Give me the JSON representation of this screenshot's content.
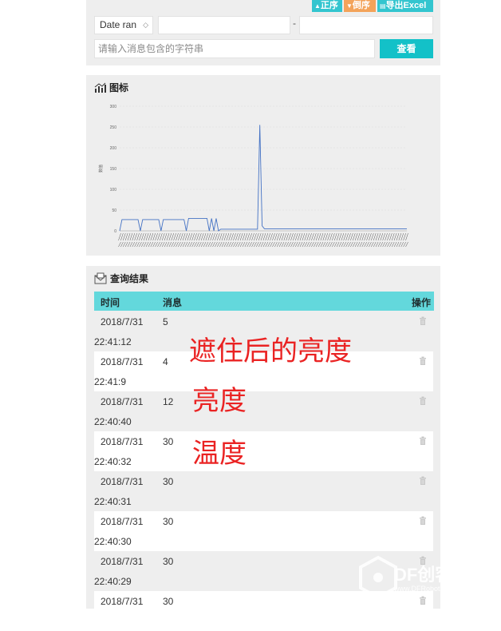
{
  "toolbar": {
    "asc_label": "正序",
    "desc_label": "倒序",
    "export_label": "导出Excel"
  },
  "filter": {
    "range_select": "Date ran",
    "search_placeholder": "请输入消息包含的字符串",
    "query_label": "查看",
    "separator": "-"
  },
  "chart_panel": {
    "title": "图标"
  },
  "result_panel": {
    "title": "查询结果",
    "columns": [
      "时间",
      "消息",
      "操作"
    ]
  },
  "rows": [
    {
      "date": "2018/7/31",
      "time": "22:41:12",
      "msg": "5"
    },
    {
      "date": "2018/7/31",
      "time": "22:41:9",
      "msg": "4"
    },
    {
      "date": "2018/7/31",
      "time": "22:40:40",
      "msg": "12"
    },
    {
      "date": "2018/7/31",
      "time": "22:40:32",
      "msg": "30"
    },
    {
      "date": "2018/7/31",
      "time": "22:40:31",
      "msg": "30"
    },
    {
      "date": "2018/7/31",
      "time": "22:40:30",
      "msg": "30"
    },
    {
      "date": "2018/7/31",
      "time": "22:40:29",
      "msg": "30"
    },
    {
      "date": "2018/7/31",
      "time": "",
      "msg": "30"
    }
  ],
  "annotations": [
    "遮住后的亮度",
    "亮度",
    "温度"
  ],
  "watermark": {
    "text": "DF创客社区",
    "url": "www.DFRobot.com.cn"
  },
  "colors": {
    "accent": "#13c1c8",
    "header": "#63d8dc",
    "desc": "#f3a35a",
    "line": "#4472c4",
    "annotation": "#ea2323"
  },
  "chart_data": {
    "type": "line",
    "title": "",
    "xlabel": "",
    "ylabel": "数值",
    "ylim": [
      0,
      300
    ],
    "yticks": [
      0,
      50,
      100,
      150,
      200,
      250,
      300
    ],
    "grid": true,
    "series": [
      {
        "values": [
          0,
          27,
          27,
          27,
          27,
          27,
          27,
          27,
          27,
          0,
          27,
          27,
          27,
          27,
          27,
          27,
          27,
          27,
          0,
          27,
          27,
          27,
          27,
          27,
          27,
          27,
          27,
          27,
          27,
          0,
          30,
          30,
          30,
          30,
          30,
          30,
          30,
          30,
          30,
          0,
          30,
          0,
          30,
          0,
          4,
          4,
          4,
          4,
          4,
          4,
          4,
          4,
          4,
          4,
          4,
          4,
          4,
          4,
          4,
          4,
          4,
          255,
          12,
          5,
          5,
          5,
          5,
          5,
          5,
          5,
          5,
          5,
          5,
          5,
          5,
          5,
          5,
          5,
          5,
          5,
          5,
          5,
          5,
          5,
          5,
          5,
          5,
          5,
          5,
          5,
          5,
          5,
          5,
          5,
          5,
          5,
          5,
          5,
          5,
          5,
          5,
          5,
          5,
          5,
          5,
          5,
          5,
          5,
          5,
          5,
          5,
          5,
          5,
          5,
          5,
          5,
          5,
          5,
          5,
          5,
          5,
          5,
          5,
          5,
          5,
          5
        ]
      }
    ]
  }
}
